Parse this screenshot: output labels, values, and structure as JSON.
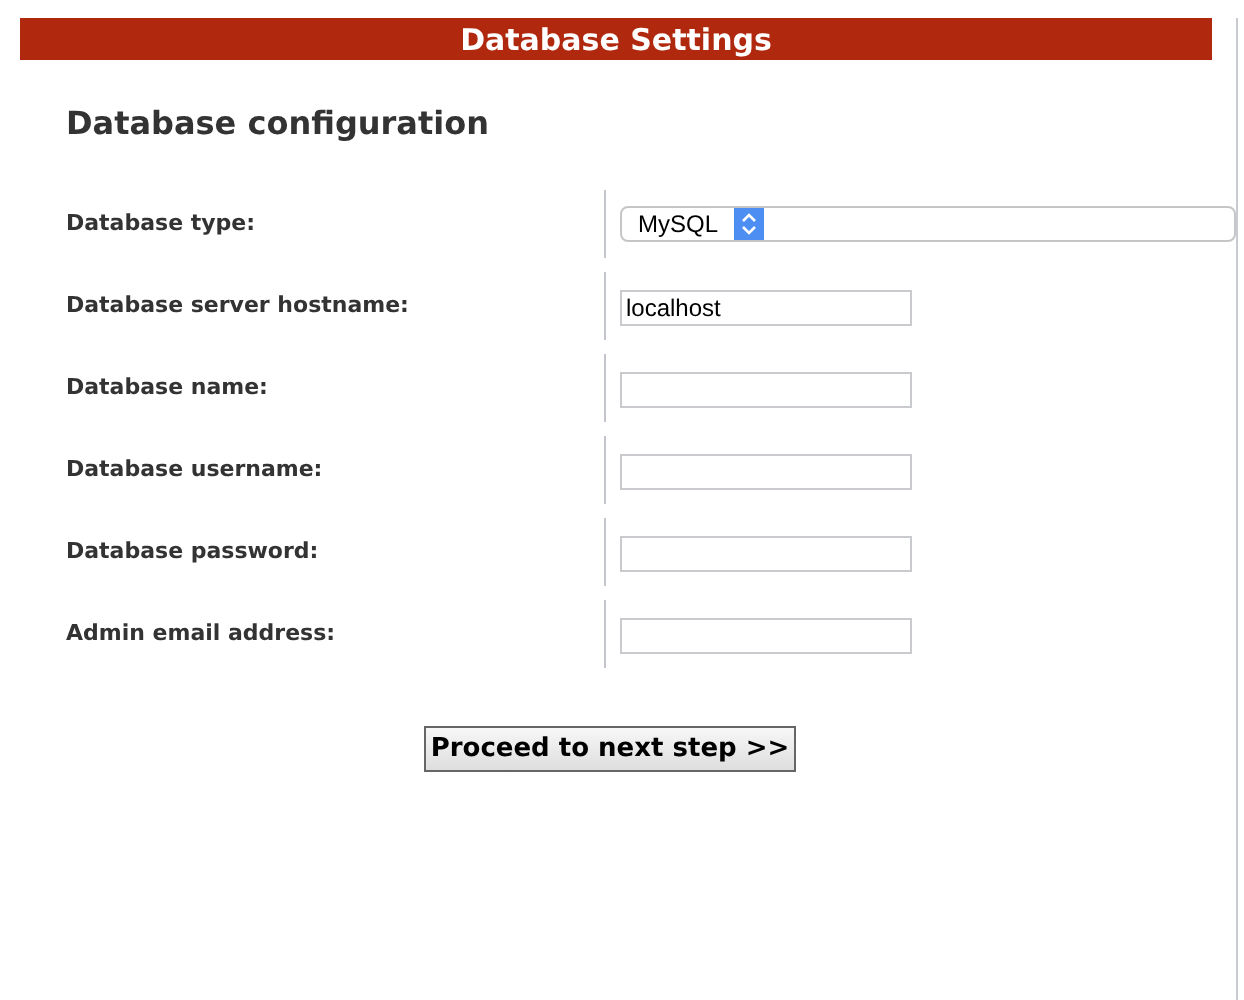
{
  "header": {
    "title": "Database Settings"
  },
  "section": {
    "title": "Database configuration"
  },
  "fields": [
    {
      "kind": "select",
      "label": "Database type:",
      "value": "MySQL"
    },
    {
      "kind": "text",
      "label": "Database server hostname:",
      "value": "localhost"
    },
    {
      "kind": "text",
      "label": "Database name:"
    },
    {
      "kind": "text",
      "label": "Database username:"
    },
    {
      "kind": "text",
      "label": "Database password:"
    },
    {
      "kind": "text",
      "label": "Admin email address:"
    }
  ],
  "submit_button": {
    "label": "Proceed to next step >>"
  }
}
